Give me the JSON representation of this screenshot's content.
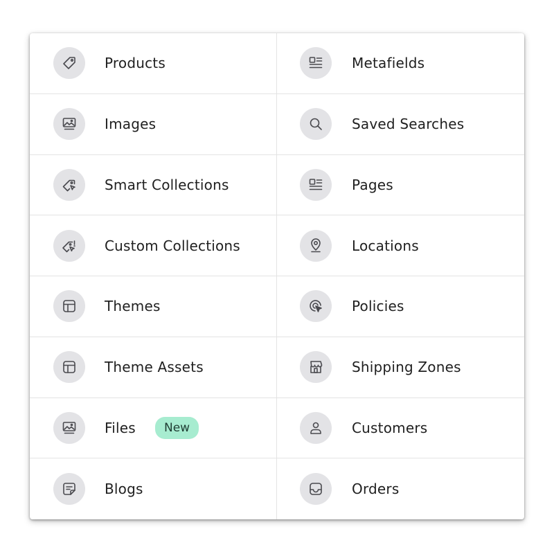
{
  "left": [
    {
      "label": "Products",
      "icon": "tag-icon"
    },
    {
      "label": "Images",
      "icon": "image-icon"
    },
    {
      "label": "Smart Collections",
      "icon": "tag-cursor-icon"
    },
    {
      "label": "Custom Collections",
      "icon": "tag-edit-cursor-icon"
    },
    {
      "label": "Themes",
      "icon": "layout-icon"
    },
    {
      "label": "Theme Assets",
      "icon": "layout-icon"
    },
    {
      "label": "Files",
      "icon": "image-icon",
      "badge": "New"
    },
    {
      "label": "Blogs",
      "icon": "note-icon"
    }
  ],
  "right": [
    {
      "label": "Metafields",
      "icon": "text-list-icon"
    },
    {
      "label": "Saved Searches",
      "icon": "search-icon"
    },
    {
      "label": "Pages",
      "icon": "text-list-icon"
    },
    {
      "label": "Locations",
      "icon": "location-pin-icon"
    },
    {
      "label": "Policies",
      "icon": "target-cursor-icon"
    },
    {
      "label": "Shipping Zones",
      "icon": "store-icon"
    },
    {
      "label": "Customers",
      "icon": "person-icon"
    },
    {
      "label": "Orders",
      "icon": "inbox-icon"
    }
  ],
  "badge_color": "#a7ecd0"
}
